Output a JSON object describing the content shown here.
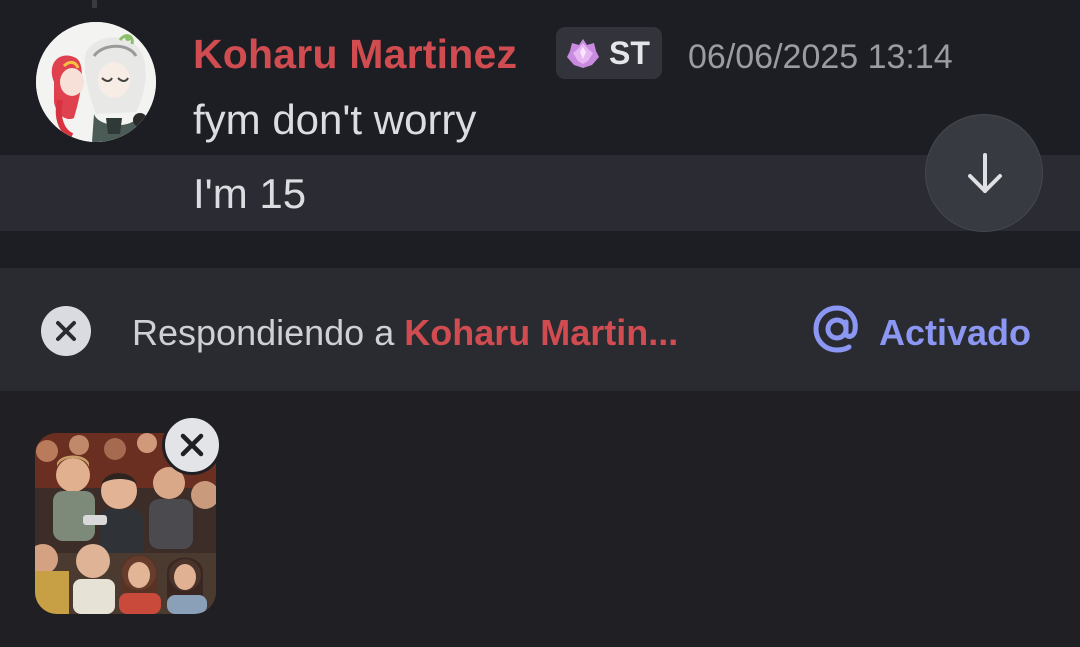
{
  "message": {
    "author": "Koharu Martinez",
    "role_tag": "ST",
    "role_tag_icon": "crystal-icon",
    "timestamp": "06/06/2025 13:14",
    "lines": [
      "fym don't worry",
      "I'm 15"
    ],
    "author_color": "#d04c50"
  },
  "scroll_button": {
    "icon": "arrow-down-icon"
  },
  "reply_bar": {
    "prefix": "Respondiendo a ",
    "target_name": "Koharu Martin...",
    "close_icon": "close-icon",
    "mention_icon": "at-icon",
    "mention_label": "Activado",
    "mention_color": "#8b97f2"
  },
  "attachment": {
    "type": "image",
    "remove_icon": "close-icon"
  },
  "colors": {
    "background": "#1f1f24",
    "highlight_row": "#2b2c33",
    "reply_bar": "#2a2b31"
  }
}
